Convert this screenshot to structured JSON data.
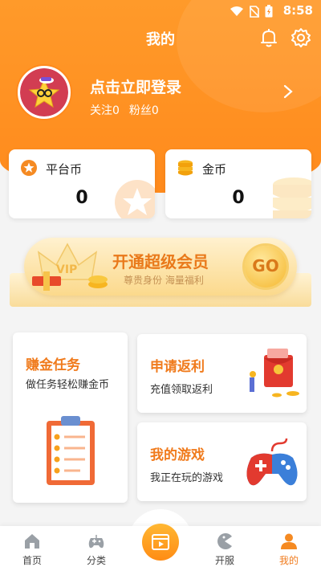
{
  "status_bar": {
    "time": "8:58"
  },
  "header": {
    "title": "我的"
  },
  "profile": {
    "login_text": "点击立即登录",
    "following": "关注0",
    "followers": "粉丝0"
  },
  "coins": [
    {
      "label": "平台币",
      "value": "0",
      "icon": "star-coin-icon"
    },
    {
      "label": "金币",
      "value": "0",
      "icon": "gold-coins-icon"
    }
  ],
  "vip_banner": {
    "badge": "VIP",
    "title": "开通超级会员",
    "subtitle": "尊贵身份  海量福利",
    "go_label": "GO"
  },
  "cards": {
    "earn": {
      "title": "赚金任务",
      "subtitle": "做任务轻松赚金币"
    },
    "rebate": {
      "title": "申请返利",
      "subtitle": "充值领取返利"
    },
    "games": {
      "title": "我的游戏",
      "subtitle": "我正在玩的游戏"
    }
  },
  "tabs": [
    {
      "label": "首页",
      "icon": "home-icon"
    },
    {
      "label": "分类",
      "icon": "gamepad-icon"
    },
    {
      "label": "",
      "icon": "video-play-icon"
    },
    {
      "label": "开服",
      "icon": "pacman-icon"
    },
    {
      "label": "我的",
      "icon": "user-icon"
    }
  ],
  "colors": {
    "accent": "#ff8a1c",
    "accent_text": "#f07b1d",
    "vip_gold": "#fbd98c"
  }
}
